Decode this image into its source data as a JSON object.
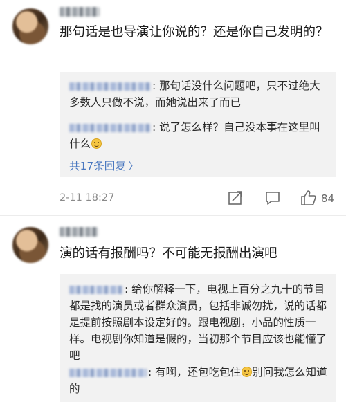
{
  "comments": [
    {
      "text": "那句话是也导演让你说的？还是你自己发明的？",
      "replies": [
        {
          "text": ": 那句话没什么问题吧，只不过绝大多数人只做不说，而她说出来了而已"
        },
        {
          "text": ": 说了怎么样？自己没本事在这里叫什么",
          "emoji": "smile-emoji"
        }
      ],
      "more_replies": "共17条回复",
      "timestamp": "2-11 18:27",
      "likes": "84"
    },
    {
      "text": "演的话有报酬吗？不可能无报酬出演吧",
      "replies": [
        {
          "text": ": 给你解释一下，电视上百分之九十的节目都是找的演员或者群众演员，包括非诚勿扰，说的话都是提前按照剧本设定好的。跟电视剧，小品的性质一样。电视剧你知道是假的，当初那个节目应该也能懂了吧"
        },
        {
          "text_a": ": 有啊，还包吃包住",
          "emoji": "smile-emoji",
          "text_b": "别问我怎么知道的"
        }
      ]
    }
  ],
  "colors": {
    "link": "#4a78c0",
    "reply_bg": "#f2f2f2",
    "meta": "#8a8a8a"
  },
  "icons": [
    "share-icon",
    "comment-icon",
    "like-icon",
    "chevron-right-icon",
    "smile-emoji"
  ]
}
